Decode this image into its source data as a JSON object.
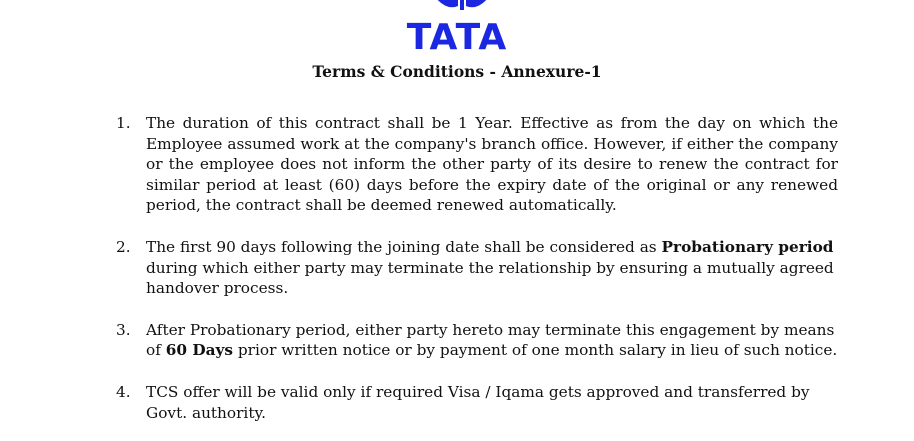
{
  "header": {
    "logo_text": "TATA",
    "logo_color": "#1b27e0",
    "logo_icon": "tata-emblem-icon",
    "title": "Terms & Conditions - Annexure-1"
  },
  "terms": [
    {
      "number": "1.",
      "text": "The duration of this contract shall be 1 Year. Effective as from the day on which the Employee assumed work at the company's branch office. However, if either the company or the employee does not inform the other party of its desire to renew the contract for similar period at least (60) days before the expiry date of the original or any renewed period, the contract shall be deemed renewed automatically."
    },
    {
      "number": "2.",
      "text_before": "The first 90 days following the joining date shall be considered as ",
      "bold": "Probationary period",
      "text_after": " during which either party may terminate the relationship by ensuring a mutually agreed handover process."
    },
    {
      "number": "3.",
      "text_before": "After Probationary period, either party hereto may terminate this engagement by means of ",
      "bold": "60 Days",
      "text_after": " prior written notice or by payment of one month salary in lieu of such notice."
    },
    {
      "number": "4.",
      "text": "TCS offer will be valid only if required Visa / Iqama gets approved and transferred by Govt. authority."
    }
  ]
}
